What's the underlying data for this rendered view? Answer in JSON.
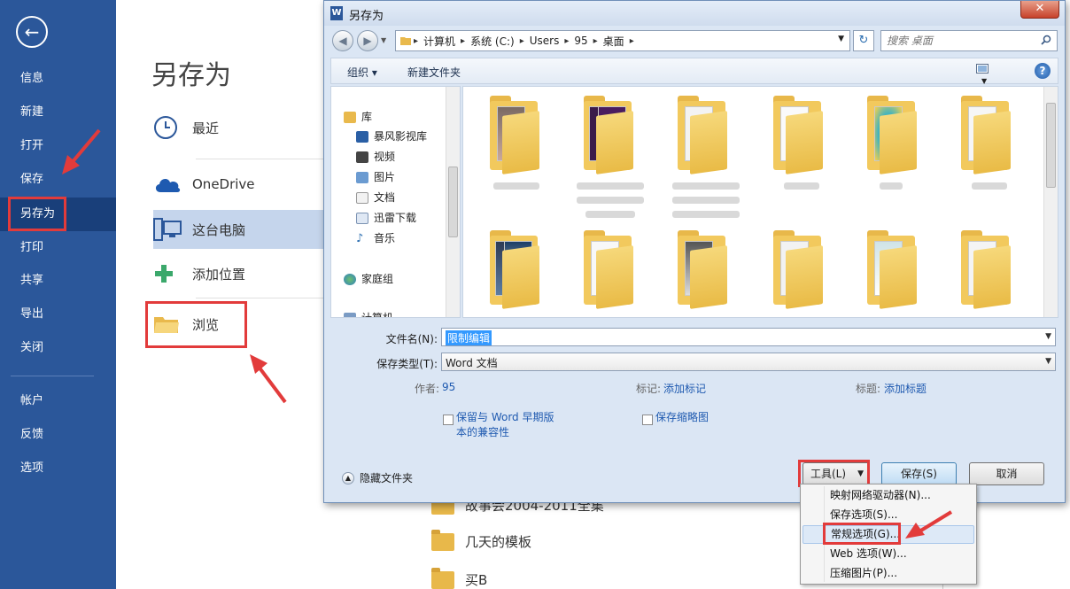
{
  "backstage": {
    "nav": [
      {
        "label": "信息",
        "active": false
      },
      {
        "label": "新建",
        "active": false
      },
      {
        "label": "打开",
        "active": false
      },
      {
        "label": "保存",
        "active": false
      },
      {
        "label": "另存为",
        "active": true
      },
      {
        "label": "打印",
        "active": false
      },
      {
        "label": "共享",
        "active": false
      },
      {
        "label": "导出",
        "active": false
      },
      {
        "label": "关闭",
        "active": false
      }
    ],
    "nav_bottom": [
      {
        "label": "帐户"
      },
      {
        "label": "反馈"
      },
      {
        "label": "选项"
      }
    ],
    "title": "另存为",
    "places": [
      {
        "label": "最近",
        "icon": "clock-icon"
      },
      {
        "label": "OneDrive",
        "icon": "cloud-icon"
      },
      {
        "label": "这台电脑",
        "icon": "computer-icon",
        "selected": true
      },
      {
        "label": "添加位置",
        "icon": "plus-icon"
      },
      {
        "label": "浏览",
        "icon": "folder-icon"
      }
    ],
    "recent_folders": [
      {
        "label": "故事会2004-2011全集"
      },
      {
        "label": "几天的模板"
      },
      {
        "label": "买B"
      }
    ]
  },
  "dialog": {
    "title": "另存为",
    "close_glyph": "✕",
    "breadcrumb": [
      "计算机",
      "系统 (C:)",
      "Users",
      "95",
      "桌面"
    ],
    "search_placeholder": "搜索 桌面",
    "toolbar": {
      "organize": "组织 ▾",
      "new_folder": "新建文件夹",
      "help": "?"
    },
    "tree": [
      {
        "label": "库",
        "top": true
      },
      {
        "label": "暴风影视库"
      },
      {
        "label": "视频"
      },
      {
        "label": "图片"
      },
      {
        "label": "文档"
      },
      {
        "label": "迅雷下载"
      },
      {
        "label": "音乐"
      },
      {
        "label": "家庭组",
        "top": true
      },
      {
        "label": "计算机",
        "top": true
      }
    ],
    "filename_label": "文件名(N):",
    "filename_value": "限制编辑",
    "filetype_label": "保存类型(T):",
    "filetype_value": "Word 文档",
    "author_label": "作者:",
    "author_value": "95",
    "tags_label": "标记:",
    "tags_value": "添加标记",
    "title_label": "标题:",
    "title_value": "添加标题",
    "compat_checkbox": "保留与 Word 早期版本的兼容性",
    "compat_line1": "保留与 Word 早期版",
    "compat_line2": "本的兼容性",
    "thumbnail_checkbox": "保存缩略图",
    "hide_folders": "隐藏文件夹",
    "tools_label": "工具(L)",
    "save_label": "保存(S)",
    "cancel_label": "取消"
  },
  "tools_menu": [
    {
      "label": "映射网络驱动器(N)..."
    },
    {
      "label": "保存选项(S)..."
    },
    {
      "label": "常规选项(G)...",
      "highlighted": true
    },
    {
      "label": "Web 选项(W)..."
    },
    {
      "label": "压缩图片(P)..."
    }
  ],
  "colors": {
    "backstage_blue": "#2b579a",
    "backstage_active": "#193f7a",
    "highlight_red": "#e23b3b",
    "link_blue": "#1f5ab0",
    "folder_yellow": "#f2c95d"
  }
}
